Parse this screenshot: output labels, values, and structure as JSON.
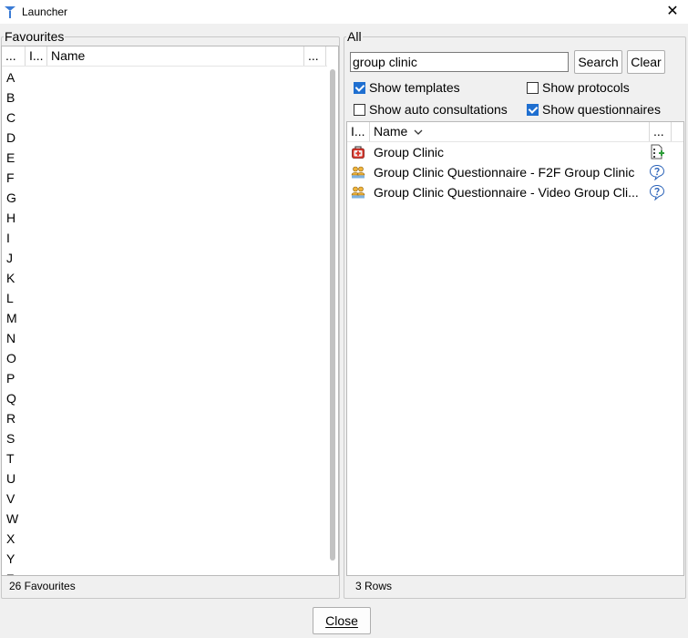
{
  "window": {
    "title": "Launcher",
    "close_glyph": "✕"
  },
  "favourites": {
    "legend": "Favourites",
    "columns": [
      "...",
      "I...",
      "Name",
      "..."
    ],
    "letters": [
      "A",
      "B",
      "C",
      "D",
      "E",
      "F",
      "G",
      "H",
      "I",
      "J",
      "K",
      "L",
      "M",
      "N",
      "O",
      "P",
      "Q",
      "R",
      "S",
      "T",
      "U",
      "V",
      "W",
      "X",
      "Y",
      "Z"
    ],
    "status": "26 Favourites"
  },
  "all": {
    "legend": "All",
    "search": {
      "value": "group clinic",
      "button": "Search",
      "clear": "Clear"
    },
    "options": {
      "show_templates": {
        "label": "Show templates",
        "checked": true
      },
      "show_protocols": {
        "label": "Show protocols",
        "checked": false
      },
      "show_auto_consultations": {
        "label": "Show auto consultations",
        "checked": false
      },
      "show_questionnaires": {
        "label": "Show questionnaires",
        "checked": true
      }
    },
    "columns": [
      "I...",
      "Name",
      "..."
    ],
    "rows": [
      {
        "name": "Group Clinic",
        "icon": "medical-kit-icon",
        "type_icon": "template-doc-icon"
      },
      {
        "name": "Group Clinic Questionnaire - F2F Group Clinic",
        "icon": "people-icon",
        "type_icon": "questionnaire-icon"
      },
      {
        "name": "Group Clinic Questionnaire - Video Group Cli...",
        "icon": "people-icon",
        "type_icon": "questionnaire-icon"
      }
    ],
    "status": "3 Rows"
  },
  "footer": {
    "close_label": "Close"
  },
  "colors": {
    "accent": "#1f6fd0",
    "background": "#f0f0f0"
  }
}
